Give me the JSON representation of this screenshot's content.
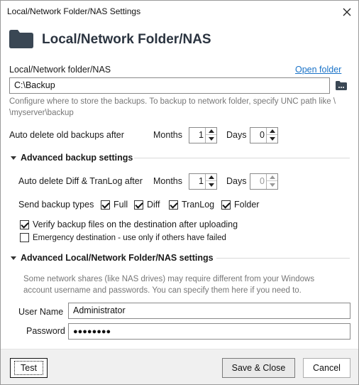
{
  "window": {
    "title": "Local/Network Folder/NAS Settings"
  },
  "header": {
    "title": "Local/Network Folder/NAS",
    "icon": "folder-icon"
  },
  "folder": {
    "label": "Local/Network folder/NAS",
    "open_link": "Open folder",
    "value": "C:\\Backup",
    "hint_line1": "Configure where to store the backups. To backup to network folder, specify UNC path like \\",
    "hint_line2": "\\myserver\\backup"
  },
  "auto_delete": {
    "label": "Auto delete old backups after",
    "months_label": "Months",
    "months_value": "1",
    "days_label": "Days",
    "days_value": "0"
  },
  "advanced_backup": {
    "header": "Advanced backup settings",
    "diff_label": "Auto delete Diff & TranLog after",
    "months_label": "Months",
    "months_value": "1",
    "days_label": "Days",
    "days_value": "0",
    "send_types_label": "Send backup types",
    "types": [
      {
        "label": "Full",
        "checked": true
      },
      {
        "label": "Diff",
        "checked": true
      },
      {
        "label": "TranLog",
        "checked": true
      },
      {
        "label": "Folder",
        "checked": true
      }
    ],
    "verify_label": "Verify backup files on the destination after uploading",
    "verify_checked": true,
    "emergency_label": "Emergency destination - use only if others have failed",
    "emergency_checked": false
  },
  "advanced_nas": {
    "header": "Advanced Local/Network Folder/NAS settings",
    "note_line1": "Some network shares (like NAS drives) may require different from your Windows",
    "note_line2": "account username and passwords. You can specify them here if you need to.",
    "username_label": "User Name",
    "username_value": "Administrator",
    "password_label": "Password",
    "password_value": "●●●●●●●●"
  },
  "footer": {
    "test_label": "Test",
    "save_label": "Save & Close",
    "cancel_label": "Cancel"
  },
  "colors": {
    "link": "#1a73c8",
    "header_text": "#2b3440",
    "folder_icon": "#3a4754"
  }
}
